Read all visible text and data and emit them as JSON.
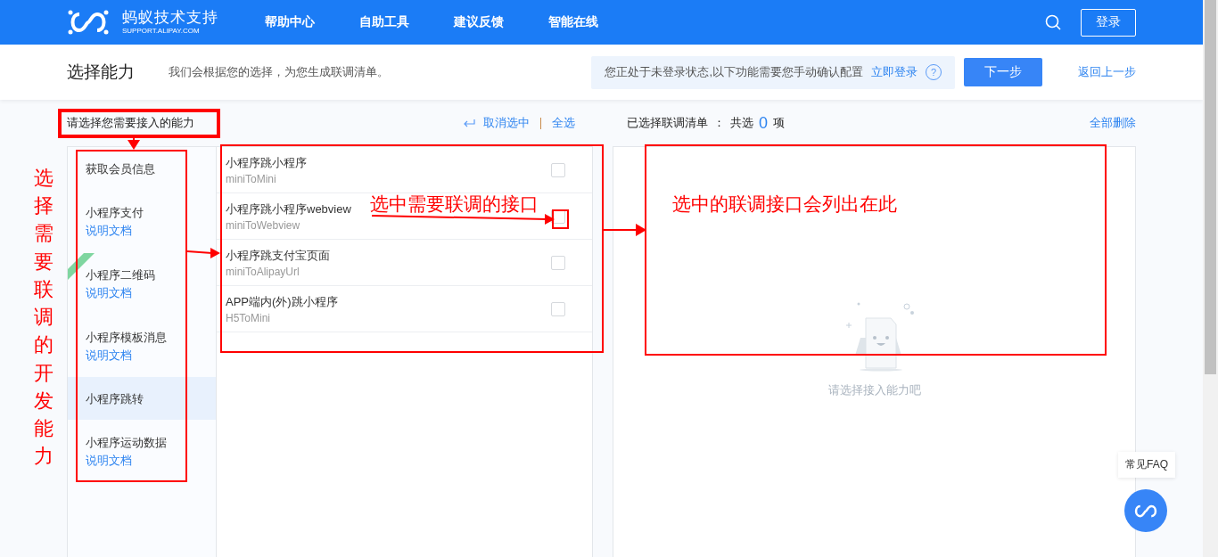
{
  "header": {
    "logo_title": "蚂蚁技术支持",
    "logo_subtitle": "SUPPORT.ALIPAY.COM",
    "nav": [
      "帮助中心",
      "自助工具",
      "建议反馈",
      "智能在线"
    ],
    "login_button": "登录"
  },
  "subheader": {
    "title": "选择能力",
    "description": "我们会根据您的选择，为您生成联调清单。",
    "notice": "您正处于未登录状态,以下功能需要您手动确认配置",
    "notice_link": "立即登录",
    "help": "?",
    "next_button": "下一步",
    "back_link": "返回上一步"
  },
  "left": {
    "heading": "请选择您需要接入的能力",
    "cancel_selection": "取消选中",
    "select_all": "全选",
    "categories": [
      {
        "name": "获取会员信息",
        "selected": false
      },
      {
        "name": "小程序支付",
        "doc_link": "说明文档",
        "selected": false
      },
      {
        "name": "小程序二维码",
        "doc_link": "说明文档",
        "selected": false
      },
      {
        "name": "小程序模板消息",
        "doc_link": "说明文档",
        "selected": false
      },
      {
        "name": "小程序跳转",
        "selected": true
      },
      {
        "name": "小程序运动数据",
        "doc_link": "说明文档",
        "selected": false
      }
    ],
    "interfaces": [
      {
        "title": "小程序跳小程序",
        "code": "miniToMini",
        "checked": false
      },
      {
        "title": "小程序跳小程序webview",
        "code": "miniToWebview",
        "checked": false
      },
      {
        "title": "小程序跳支付宝页面",
        "code": "miniToAlipayUrl",
        "checked": false
      },
      {
        "title": "APP端内(外)跳小程序",
        "code": "H5ToMini",
        "checked": false
      }
    ]
  },
  "right": {
    "label": "已选择联调清单",
    "colon": "：",
    "total_prefix": "共选",
    "count": "0",
    "total_suffix": "项",
    "delete_all": "全部删除",
    "empty_text": "请选择接入能力吧"
  },
  "faq": {
    "label": "常见FAQ"
  },
  "annotations": {
    "sidebar_note": "选择需要联调的开发能力",
    "interface_note": "选中需要联调的接口",
    "result_note": "选中的联调接口会列出在此"
  }
}
